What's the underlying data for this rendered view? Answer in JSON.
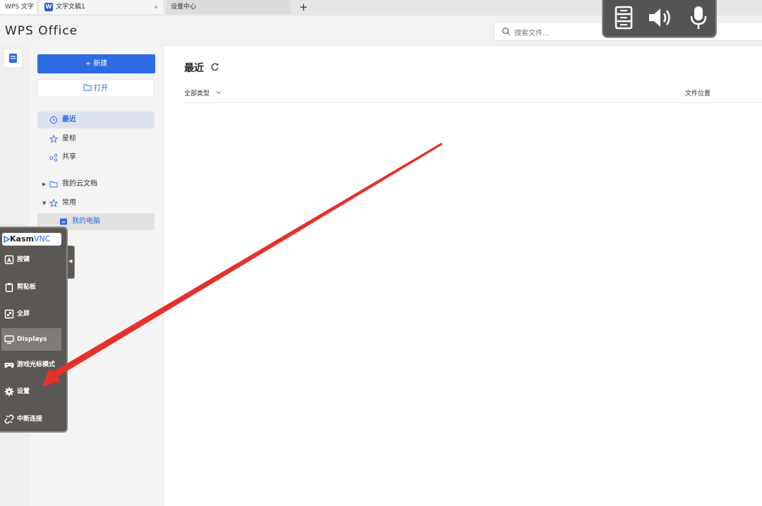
{
  "tabs": {
    "home_label": "WPS 文字",
    "doc_icon": "W",
    "doc_label": "文字文稿1",
    "settings_label": "设置中心",
    "add_label": "+"
  },
  "header": {
    "logo": "WPS Office",
    "search_placeholder": "搜索文件..."
  },
  "media_overlay": {
    "icons": [
      "server-icon",
      "speaker-icon",
      "microphone-icon"
    ]
  },
  "sidebar": {
    "new_button": "+ 新建",
    "open_button": "打开",
    "nav": [
      {
        "label": "最近",
        "icon": "clock-icon",
        "active": true
      },
      {
        "label": "星标",
        "icon": "star-icon"
      },
      {
        "label": "共享",
        "icon": "share-icon"
      }
    ],
    "tree": [
      {
        "label": "我的云文档",
        "icon": "folder-icon",
        "arrow": "▶"
      },
      {
        "label": "常用",
        "icon": "star-icon",
        "arrow": "▼"
      },
      {
        "label": "我的电脑",
        "icon": "computer-icon"
      }
    ]
  },
  "main": {
    "title": "最近",
    "filter_label": "全部类型",
    "column_location": "文件位置"
  },
  "kasm": {
    "logo_kasm": "Kasm",
    "logo_vnc": "VNC",
    "items": [
      {
        "label": "按键",
        "icon": "keyboard-key-icon"
      },
      {
        "label": "剪贴板",
        "icon": "clipboard-icon"
      },
      {
        "label": "全屏",
        "icon": "fullscreen-icon"
      },
      {
        "label": "Displays",
        "icon": "monitor-icon",
        "active": true
      },
      {
        "label": "游戏光标模式",
        "icon": "gamepad-icon"
      },
      {
        "label": "设置",
        "icon": "gear-icon"
      },
      {
        "label": "中断连接",
        "icon": "disconnect-icon"
      }
    ]
  },
  "colors": {
    "accent": "#2d6be5",
    "annotation_arrow": "#e8302a"
  }
}
